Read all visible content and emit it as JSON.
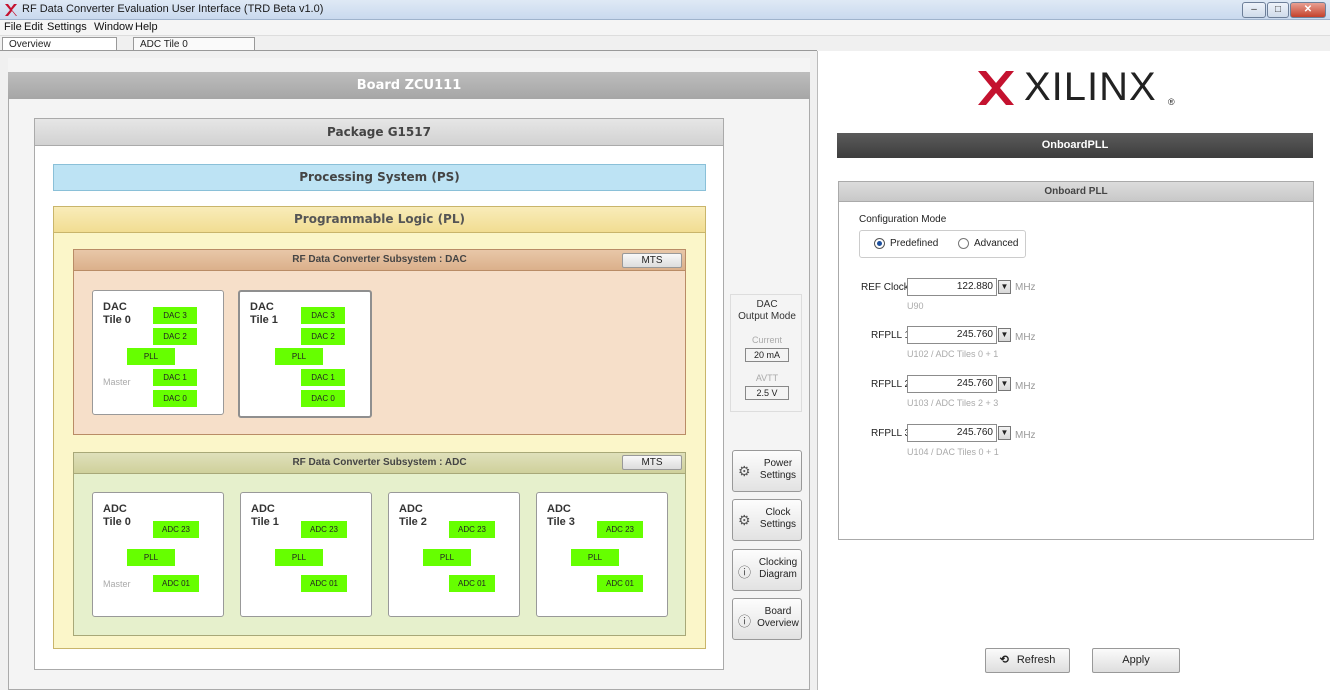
{
  "window": {
    "title": "RF Data Converter Evaluation User Interface (TRD Beta v1.0)"
  },
  "menu": {
    "items": [
      "File",
      "Edit",
      "Settings",
      "Window",
      "Help"
    ]
  },
  "tabs": [
    {
      "label": "Overview"
    },
    {
      "label": "ADC Tile 0"
    }
  ],
  "board": {
    "title": "Board ZCU111"
  },
  "package": {
    "title": "Package G1517"
  },
  "ps": {
    "title": "Processing System (PS)"
  },
  "pl": {
    "title": "Programmable Logic (PL)"
  },
  "dac_subsystem": {
    "title": "RF Data Converter Subsystem : DAC",
    "mts": "MTS",
    "tiles": [
      {
        "title_line1": "DAC",
        "title_line2": "Tile 0",
        "chips": [
          "DAC 3",
          "DAC 2",
          "PLL",
          "DAC 1",
          "DAC 0"
        ],
        "master": "Master"
      },
      {
        "title_line1": "DAC",
        "title_line2": "Tile 1",
        "chips": [
          "DAC 3",
          "DAC 2",
          "PLL",
          "DAC 1",
          "DAC 0"
        ],
        "master": ""
      }
    ]
  },
  "adc_subsystem": {
    "title": "RF Data Converter Subsystem : ADC",
    "mts": "MTS",
    "tiles": [
      {
        "title_line1": "ADC",
        "title_line2": "Tile 0",
        "chips": [
          "ADC 23",
          "PLL",
          "ADC 01"
        ],
        "master": "Master"
      },
      {
        "title_line1": "ADC",
        "title_line2": "Tile 1",
        "chips": [
          "ADC 23",
          "PLL",
          "ADC 01"
        ],
        "master": ""
      },
      {
        "title_line1": "ADC",
        "title_line2": "Tile 2",
        "chips": [
          "ADC 23",
          "PLL",
          "ADC 01"
        ],
        "master": ""
      },
      {
        "title_line1": "ADC",
        "title_line2": "Tile 3",
        "chips": [
          "ADC 23",
          "PLL",
          "ADC 01"
        ],
        "master": ""
      }
    ]
  },
  "dac_output_mode": {
    "title_line1": "DAC",
    "title_line2": "Output Mode",
    "current_label": "Current",
    "current_value": "20 mA",
    "avtt_label": "AVTT",
    "avtt_value": "2.5 V"
  },
  "side_buttons": [
    {
      "line1": "Power",
      "line2": "Settings",
      "icon": "gear-icon"
    },
    {
      "line1": "Clock",
      "line2": "Settings",
      "icon": "gear-icon"
    },
    {
      "line1": "Clocking",
      "line2": "Diagram",
      "icon": "info-icon"
    },
    {
      "line1": "Board",
      "line2": "Overview",
      "icon": "info-icon"
    }
  ],
  "logo": {
    "text": "XILINX",
    "reg": "®",
    "color": "#c4122f"
  },
  "onboard_pll": {
    "header": "OnboardPLL",
    "panel_title": "Onboard PLL",
    "config_mode_label": "Configuration Mode",
    "modes": [
      {
        "label": "Predefined",
        "selected": true
      },
      {
        "label": "Advanced",
        "selected": false
      }
    ],
    "ref_clock": {
      "label": "REF Clock",
      "value": "122.880",
      "unit": "MHz",
      "hint": "U90"
    },
    "plls": [
      {
        "label": "RFPLL 1",
        "value": "245.760",
        "unit": "MHz",
        "hint": "U102 / ADC Tiles 0 + 1"
      },
      {
        "label": "RFPLL 2",
        "value": "245.760",
        "unit": "MHz",
        "hint": "U103 / ADC Tiles 2 + 3"
      },
      {
        "label": "RFPLL 3",
        "value": "245.760",
        "unit": "MHz",
        "hint": "U104 / DAC Tiles 0 + 1"
      }
    ]
  },
  "actions": {
    "refresh": "Refresh",
    "apply": "Apply"
  }
}
